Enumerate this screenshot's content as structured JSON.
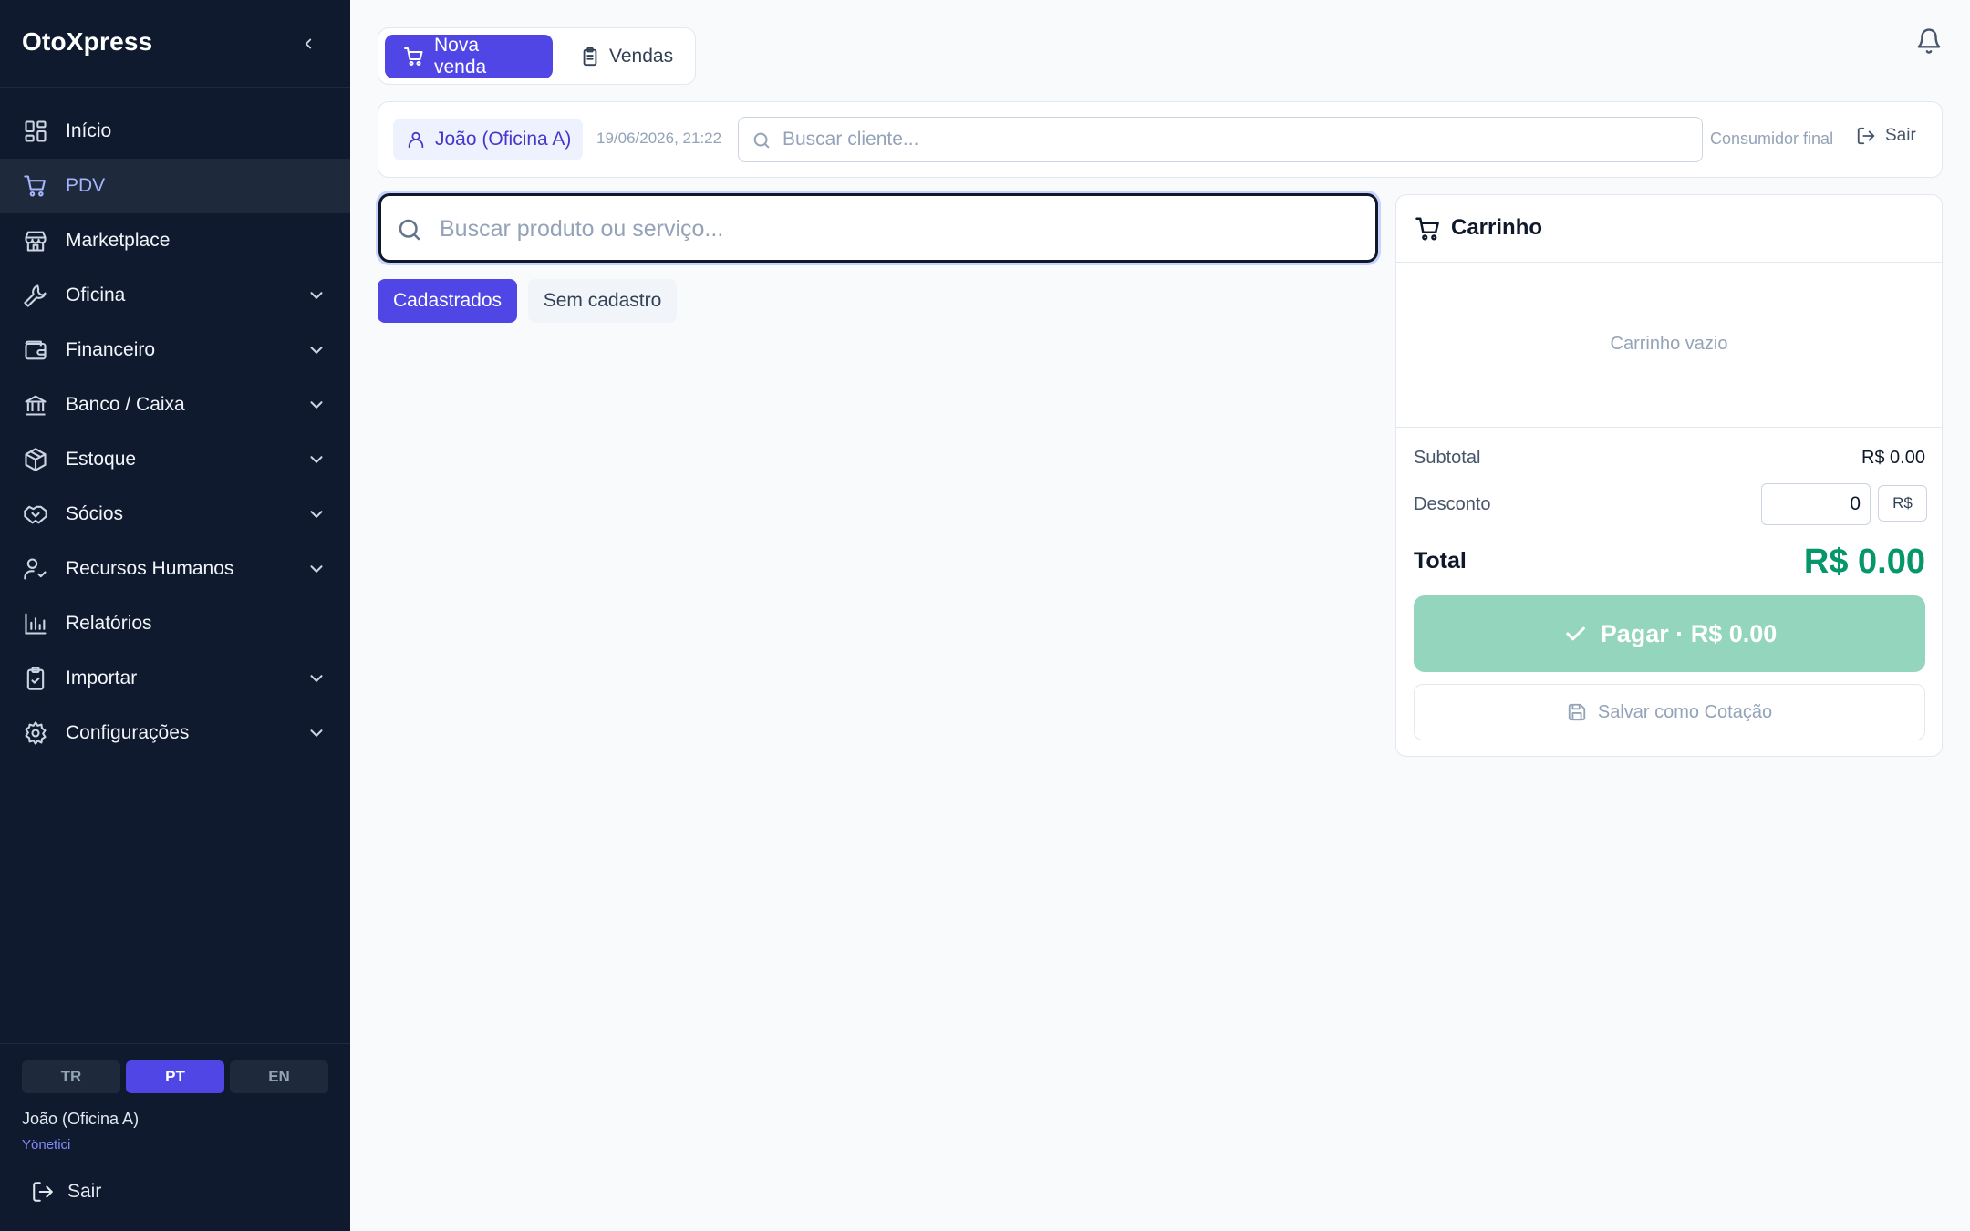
{
  "sidebar": {
    "brand": "OtoXpress",
    "items": [
      {
        "label": "Início",
        "icon": "grid-icon",
        "expandable": false,
        "active": false
      },
      {
        "label": "PDV",
        "icon": "cart-icon",
        "expandable": false,
        "active": true
      },
      {
        "label": "Marketplace",
        "icon": "store-icon",
        "expandable": false,
        "active": false
      },
      {
        "label": "Oficina",
        "icon": "wrench-icon",
        "expandable": true,
        "active": false
      },
      {
        "label": "Financeiro",
        "icon": "wallet-icon",
        "expandable": true,
        "active": false
      },
      {
        "label": "Banco / Caixa",
        "icon": "bank-icon",
        "expandable": true,
        "active": false
      },
      {
        "label": "Estoque",
        "icon": "package-icon",
        "expandable": true,
        "active": false
      },
      {
        "label": "Sócios",
        "icon": "handshake-icon",
        "expandable": true,
        "active": false
      },
      {
        "label": "Recursos Humanos",
        "icon": "user-check-icon",
        "expandable": true,
        "active": false
      },
      {
        "label": "Relatórios",
        "icon": "bar-chart-icon",
        "expandable": false,
        "active": false
      },
      {
        "label": "Importar",
        "icon": "clipboard-check-icon",
        "expandable": true,
        "active": false
      },
      {
        "label": "Configurações",
        "icon": "settings-icon",
        "expandable": true,
        "active": false
      }
    ],
    "languages": [
      {
        "code": "TR",
        "active": false
      },
      {
        "code": "PT",
        "active": true
      },
      {
        "code": "EN",
        "active": false
      }
    ],
    "user": {
      "name": "João (Oficina A)",
      "role": "Yönetici"
    },
    "logout_label": "Sair"
  },
  "tabs": {
    "new_sale": "Nova venda",
    "sales": "Vendas"
  },
  "client_bar": {
    "operator": "João (Oficina A)",
    "datetime": "19/06/2026, 21:22",
    "search_placeholder": "Buscar cliente...",
    "consumer_label": "Consumidor final",
    "exit_label": "Sair"
  },
  "product_search": {
    "placeholder": "Buscar produto ou serviço..."
  },
  "filters": {
    "registered": "Cadastrados",
    "unregistered": "Sem cadastro"
  },
  "cart": {
    "title": "Carrinho",
    "empty": "Carrinho vazio",
    "subtotal_label": "Subtotal",
    "subtotal_value": "R$ 0.00",
    "discount_label": "Desconto",
    "discount_value": "0",
    "discount_unit": "R$",
    "total_label": "Total",
    "total_value": "R$ 0.00",
    "pay_label": "Pagar · R$ 0.00",
    "quote_label": "Salvar como Cotação"
  },
  "colors": {
    "sidebar_bg": "#101a2e",
    "accent": "#4f46e5",
    "total_green": "#059669",
    "pay_button": "#93d5bd"
  }
}
